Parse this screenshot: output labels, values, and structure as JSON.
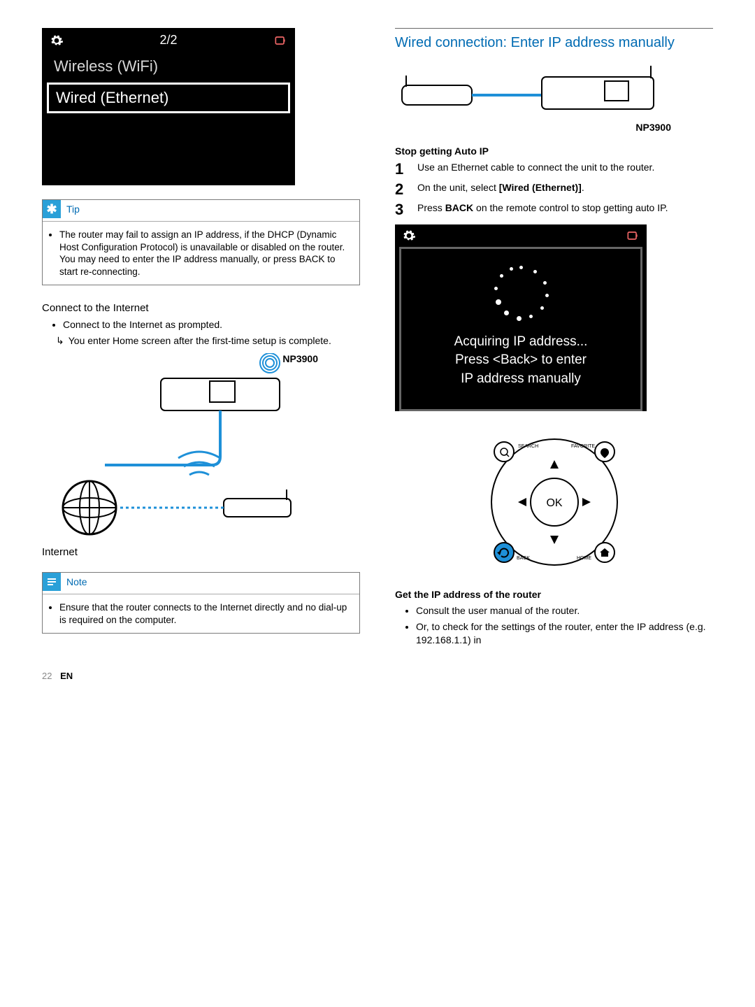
{
  "screen1": {
    "page_indicator": "2/2",
    "item1": "Wireless (WiFi)",
    "item2": "Wired (Ethernet)"
  },
  "tip": {
    "title": "Tip",
    "body": "The router may fail to assign an IP address, if the DHCP (Dynamic Host Configuration Protocol) is unavailable or disabled on the router. You may need to enter the IP address manually, or press BACK to start re-connecting."
  },
  "connect_internet": {
    "heading": "Connect to the Internet",
    "b1": "Connect to the Internet as prompted.",
    "sub1": "You enter Home screen after the first-time setup is complete."
  },
  "illus1": {
    "device_label": "NP3900",
    "internet_label": "Internet"
  },
  "note": {
    "title": "Note",
    "body": "Ensure that the router connects to the Internet directly and no dial-up is required on the computer."
  },
  "wired_manual": {
    "heading": "Wired connection: Enter IP address manually",
    "device_label": "NP3900",
    "stop_heading": "Stop getting Auto IP",
    "s1": "Use an Ethernet cable to connect the unit to the router.",
    "s2_a": "On the unit, select ",
    "s2_b": "[Wired (Ethernet)]",
    "s2_c": ".",
    "s3_a": "Press ",
    "s3_b": "BACK",
    "s3_c": " on the remote control to stop getting auto IP."
  },
  "spinner": {
    "l1": "Acquiring IP address...",
    "l2": "Press <Back> to enter",
    "l3": "IP address manually"
  },
  "remote": {
    "search": "SEARCH",
    "favorite": "FAVORITE",
    "back": "BACK",
    "home": "HOME",
    "ok": "OK"
  },
  "get_ip": {
    "heading": "Get the IP address of the router",
    "b1": "Consult the user manual of the router.",
    "b2": "Or, to check for the settings of the router, enter the IP address (e.g. 192.168.1.1) in"
  },
  "footer": {
    "page": "22",
    "lang": "EN"
  }
}
